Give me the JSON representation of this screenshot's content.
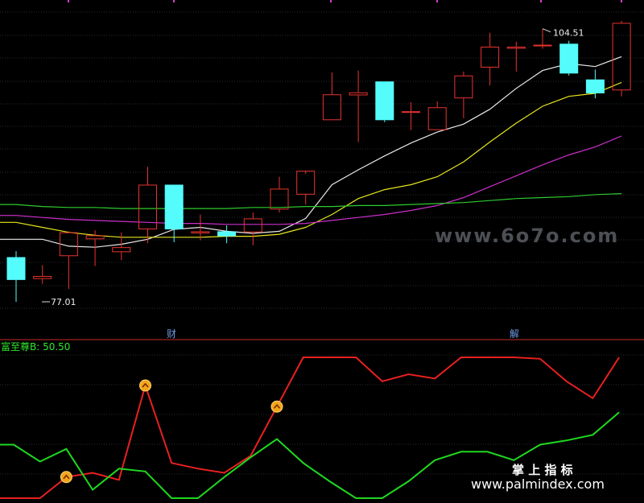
{
  "watermarks": {
    "top": "www.6o7o.com",
    "bottom_cn": "掌 上 指 标",
    "bottom_url": "www.palmindex.com"
  },
  "date_markers": [
    "财",
    "解"
  ],
  "indicator_label": "富至尊B: 50.50",
  "colors": {
    "up": "#e8332f",
    "down": "#54fcfc",
    "ma_white": "#e8e8e8",
    "ma_yellow": "#e6e61e",
    "ma_magenta": "#cc2fcc",
    "ma_green": "#2ecc2e",
    "red_line": "#e82020",
    "green_line": "#1fd81f",
    "grid": "#262a33",
    "divider": "#c82a2a",
    "label_green": "#2ee82e"
  },
  "chart_data": [
    {
      "type": "candlestick",
      "title": "",
      "ylim": [
        74,
        107
      ],
      "high_annotation": "104.51",
      "low_annotation": "77.01",
      "candles": [
        {
          "o": 81.5,
          "h": 82.1,
          "l": 77.0,
          "c": 79.2
        },
        {
          "o": 79.3,
          "h": 80.7,
          "l": 78.8,
          "c": 79.6
        },
        {
          "o": 81.6,
          "h": 84.1,
          "l": 78.3,
          "c": 84.0
        },
        {
          "o": 83.3,
          "h": 84.2,
          "l": 80.6,
          "c": 83.7
        },
        {
          "o": 82.0,
          "h": 84.0,
          "l": 81.2,
          "c": 82.5
        },
        {
          "o": 84.3,
          "h": 90.6,
          "l": 82.9,
          "c": 88.8
        },
        {
          "o": 88.8,
          "h": 88.8,
          "l": 83.0,
          "c": 84.3
        },
        {
          "o": 83.9,
          "h": 85.8,
          "l": 83.2,
          "c": 84.1
        },
        {
          "o": 84.1,
          "h": 84.7,
          "l": 82.9,
          "c": 83.6
        },
        {
          "o": 84.0,
          "h": 86.0,
          "l": 82.7,
          "c": 85.4
        },
        {
          "o": 86.3,
          "h": 89.6,
          "l": 86.0,
          "c": 88.4
        },
        {
          "o": 87.8,
          "h": 89.9,
          "l": 86.8,
          "c": 90.2
        },
        {
          "o": 95.3,
          "h": 100.1,
          "l": 95.3,
          "c": 97.9
        },
        {
          "o": 97.8,
          "h": 100.3,
          "l": 93.1,
          "c": 98.1
        },
        {
          "o": 99.2,
          "h": 99.2,
          "l": 95.1,
          "c": 95.3
        },
        {
          "o": 96.2,
          "h": 97.1,
          "l": 94.3,
          "c": 96.2
        },
        {
          "o": 94.3,
          "h": 97.2,
          "l": 94.3,
          "c": 96.6
        },
        {
          "o": 97.5,
          "h": 100.2,
          "l": 95.5,
          "c": 99.8
        },
        {
          "o": 100.6,
          "h": 104.1,
          "l": 98.8,
          "c": 102.7
        },
        {
          "o": 102.5,
          "h": 103.2,
          "l": 100.2,
          "c": 102.7
        },
        {
          "o": 102.9,
          "h": 104.51,
          "l": 102.5,
          "c": 102.9
        },
        {
          "o": 103.0,
          "h": 103.3,
          "l": 99.8,
          "c": 100.0
        },
        {
          "o": 99.4,
          "h": 100.4,
          "l": 97.5,
          "c": 98.0
        },
        {
          "o": 98.3,
          "h": 105.3,
          "l": 97.7,
          "c": 105.1
        }
      ],
      "ma_lines": [
        {
          "color_key": "ma_white",
          "values": [
            83.3,
            83.3,
            82.6,
            82.5,
            82.8,
            83.3,
            84.3,
            84.5,
            84.1,
            83.9,
            84.1,
            85.4,
            88.8,
            90.3,
            91.7,
            93.0,
            94.1,
            94.9,
            96.4,
            98.5,
            100.3,
            101.0,
            100.7,
            101.7
          ]
        },
        {
          "color_key": "ma_yellow",
          "values": [
            85.0,
            84.5,
            84.0,
            83.7,
            83.5,
            83.5,
            83.5,
            83.5,
            83.6,
            83.6,
            83.8,
            84.5,
            85.8,
            87.4,
            88.3,
            88.8,
            89.6,
            91.1,
            93.1,
            95.0,
            96.7,
            97.7,
            98.0,
            99.1
          ]
        },
        {
          "color_key": "ma_magenta",
          "values": [
            85.7,
            85.5,
            85.3,
            85.2,
            85.1,
            85.0,
            84.9,
            84.9,
            84.8,
            84.8,
            84.8,
            84.9,
            85.2,
            85.5,
            85.8,
            86.2,
            86.7,
            87.5,
            88.6,
            89.7,
            90.8,
            91.8,
            92.6,
            93.7
          ]
        },
        {
          "color_key": "ma_green",
          "values": [
            86.8,
            86.6,
            86.5,
            86.5,
            86.4,
            86.4,
            86.4,
            86.4,
            86.4,
            86.5,
            86.5,
            86.6,
            86.6,
            86.7,
            86.7,
            86.8,
            86.9,
            87.0,
            87.2,
            87.4,
            87.5,
            87.6,
            87.8,
            87.9
          ]
        }
      ]
    },
    {
      "type": "line",
      "title": "富至尊B: 50.50",
      "ylim": [
        0,
        100
      ],
      "series": [
        {
          "color_key": "red_line",
          "values": [
            0,
            0,
            15,
            18,
            13,
            80,
            25,
            21,
            18,
            30,
            65,
            100,
            100,
            100,
            83,
            88,
            85,
            100,
            100,
            100,
            99,
            83,
            71,
            100
          ]
        },
        {
          "color_key": "green_line",
          "values": [
            38,
            26,
            35,
            6,
            21,
            19,
            0,
            0,
            15,
            29,
            42,
            25,
            12,
            0,
            0,
            12,
            27,
            33,
            33,
            27,
            38,
            41,
            45,
            61
          ]
        }
      ],
      "markers": [
        2,
        5,
        10
      ]
    }
  ]
}
